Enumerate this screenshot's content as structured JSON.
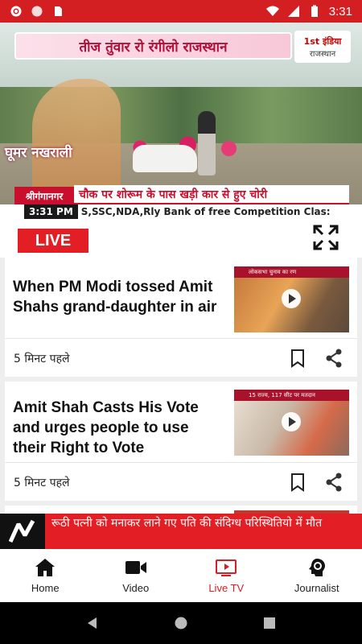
{
  "status_bar": {
    "time": "3:31"
  },
  "player": {
    "headline_banner": "तीज तुंवार रो रंगीलो राजस्थान",
    "channel_logo_line1": "1st इंडिया",
    "channel_logo_line2": "राजस्थान",
    "show_name": "घूमर नखराली",
    "city_tag": "श्रीगंगानगर",
    "news_strip": "चौक पर शोरूम के पास खड़ी कार से हुए चोरी",
    "ticker_time": "3:31 PM",
    "ticker_text": "S,SSC,NDA,Rly Bank of free Competition Clas:"
  },
  "live": {
    "label": "LIVE"
  },
  "cards": [
    {
      "title_line1": "When PM Modi tossed Amit",
      "title_line2": "Shahs grand-daughter in air",
      "title_line3": "",
      "thumb_caption": "लोकसभा चुनाव का रण",
      "time_ago": "5 मिनट पहले"
    },
    {
      "title_line1": "Amit Shah Casts His Vote",
      "title_line2": "and urges people to use",
      "title_line3": "their Right to Vote",
      "thumb_caption": "15 राज्य, 117 सीट पर मतदान",
      "time_ago": "5 मिनट पहले"
    }
  ],
  "breaking": {
    "text": "रूठी पत्नी को मनाकर लाने गए पति की संदिग्ध परिस्थितियो में मौत"
  },
  "bottom_nav": [
    {
      "label": "Home",
      "icon": "home-icon"
    },
    {
      "label": "Video",
      "icon": "video-camera-icon"
    },
    {
      "label": "Live TV",
      "icon": "tv-play-icon",
      "active": true
    },
    {
      "label": "Journalist",
      "icon": "journalist-icon"
    }
  ],
  "colors": {
    "brand_red": "#d41f22",
    "live_red": "#e31e24",
    "active_nav": "#d41f22"
  }
}
